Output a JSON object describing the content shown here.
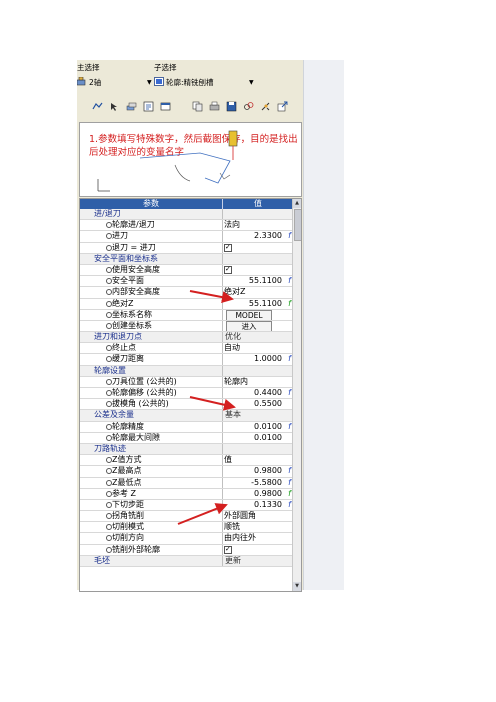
{
  "top": {
    "main_label": "主选择",
    "sub_label": "子选择",
    "main_select": "2轴",
    "sub_select": "轮廓:精铣刨槽"
  },
  "toolbar": {
    "icons": [
      "strategy-icon",
      "arrow-icon",
      "layers-icon",
      "tool-icon",
      "window-icon",
      "copy-icon",
      "print-icon",
      "save-icon",
      "link-icon",
      "settings-icon",
      "export-icon"
    ]
  },
  "preview": {
    "annotation": "1.参数填写特殊数字，然后截图保存，目的是找出后处理对应的变量名字"
  },
  "grid": {
    "col_param": "参数",
    "col_value": "值",
    "rows": [
      {
        "type": "group",
        "name": "进/退刀",
        "value": ""
      },
      {
        "type": "item",
        "name": "轮廓进/退刀",
        "value": "法向"
      },
      {
        "type": "item",
        "name": "进刀",
        "value": "2.3300",
        "fx": "f"
      },
      {
        "type": "item",
        "name": "退刀 = 进刀",
        "value": "",
        "check": true
      },
      {
        "type": "group",
        "name": "安全平面和坐标系",
        "value": ""
      },
      {
        "type": "item",
        "name": "使用安全高度",
        "value": "",
        "check": true
      },
      {
        "type": "item",
        "name": "安全平面",
        "value": "55.1100",
        "fx": "f"
      },
      {
        "type": "item",
        "name": "内部安全高度",
        "value": "绝对Z"
      },
      {
        "type": "item",
        "name": "绝对Z",
        "value": "55.1100",
        "fx": "f",
        "fx_green": true
      },
      {
        "type": "item",
        "name": "坐标系名称",
        "value": "MODEL",
        "button": true
      },
      {
        "type": "item",
        "name": "创建坐标系",
        "value": "进入",
        "button": true
      },
      {
        "type": "group",
        "name": "进刀和退刀点",
        "value": "优化"
      },
      {
        "type": "item",
        "name": "终止点",
        "value": "自动"
      },
      {
        "type": "item",
        "name": "缓刀距离",
        "value": "1.0000",
        "fx": "f"
      },
      {
        "type": "group",
        "name": "轮廓设置",
        "value": ""
      },
      {
        "type": "item",
        "name": "刀具位置 (公共的)",
        "value": "轮廓内"
      },
      {
        "type": "item",
        "name": "轮廓偏移 (公共的)",
        "value": "0.4400",
        "fx": "f"
      },
      {
        "type": "item",
        "name": "拔模角 (公共的)",
        "value": "0.5500"
      },
      {
        "type": "group",
        "name": "公差及余量",
        "value": "基本"
      },
      {
        "type": "item",
        "name": "轮廓精度",
        "value": "0.0100",
        "fx": "f"
      },
      {
        "type": "item",
        "name": "轮廓最大间隙",
        "value": "0.0100"
      },
      {
        "type": "group",
        "name": "刀路轨迹",
        "value": ""
      },
      {
        "type": "item",
        "name": "Z值方式",
        "value": "值"
      },
      {
        "type": "item",
        "name": "Z最高点",
        "value": "0.9800",
        "fx": "f"
      },
      {
        "type": "item",
        "name": "Z最低点",
        "value": "-5.5800",
        "fx": "f"
      },
      {
        "type": "item",
        "name": "参考 Z",
        "value": "0.9800",
        "fx": "f",
        "fx_green": true
      },
      {
        "type": "item",
        "name": "下切步距",
        "value": "0.1330",
        "fx": "f"
      },
      {
        "type": "item",
        "name": "拐角铣削",
        "value": "外部圆角"
      },
      {
        "type": "item",
        "name": "切削模式",
        "value": "顺铣"
      },
      {
        "type": "item",
        "name": "切削方向",
        "value": "由内往外"
      },
      {
        "type": "item",
        "name": "铣削外部轮廓",
        "value": "",
        "check": true
      },
      {
        "type": "group",
        "name": "毛坯",
        "value": "更新"
      }
    ]
  },
  "colors": {
    "header_bg": "#2f5fa8",
    "annotation": "#d42020",
    "arrow": "#d42020",
    "group_text": "#1a2f8c"
  }
}
